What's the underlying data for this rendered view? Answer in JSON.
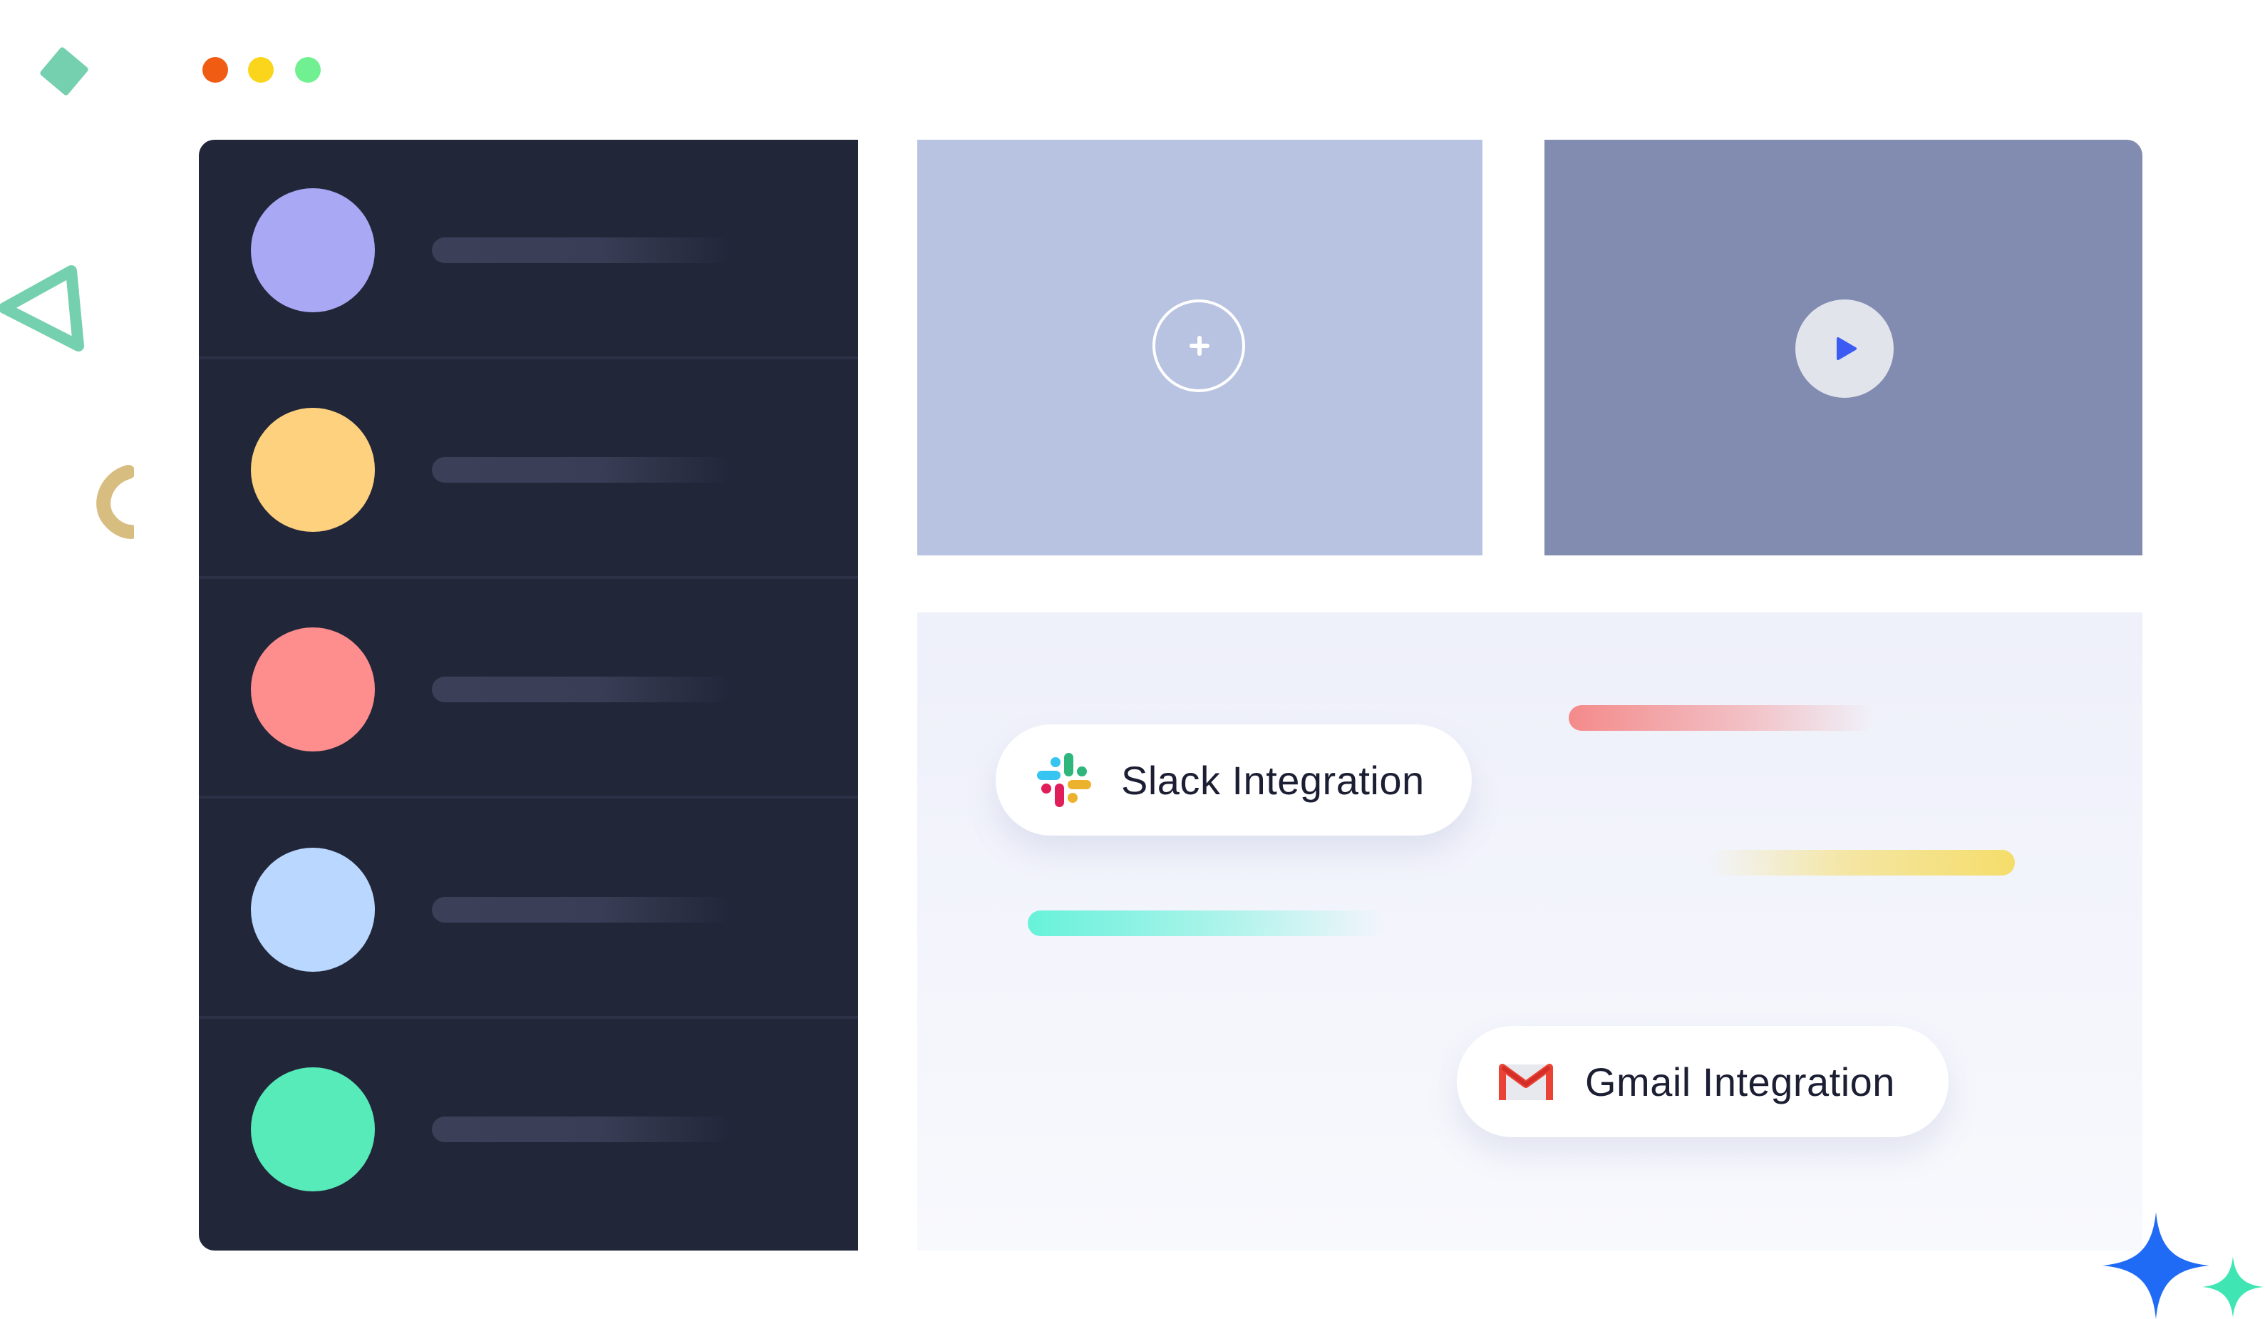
{
  "window": {
    "controls": [
      {
        "name": "close",
        "color": "#ef5c12"
      },
      {
        "name": "minimize",
        "color": "#fad51c"
      },
      {
        "name": "maximize",
        "color": "#70f090"
      }
    ]
  },
  "sidebar": {
    "items": [
      {
        "avatar_color": "#a8a8f5"
      },
      {
        "avatar_color": "#fed17f"
      },
      {
        "avatar_color": "#fe8e8e"
      },
      {
        "avatar_color": "#bad8ff"
      },
      {
        "avatar_color": "#58ebba"
      }
    ]
  },
  "cards": {
    "add": {
      "icon": "plus-icon",
      "color": "#b8c3e2"
    },
    "play": {
      "icon": "play-icon",
      "color": "#818cb0",
      "icon_color": "#3c5bf2"
    }
  },
  "integrations": [
    {
      "label": "Slack Integration",
      "icon": "slack-icon"
    },
    {
      "label": "Gmail Integration",
      "icon": "gmail-icon"
    }
  ],
  "accent_bars": [
    {
      "color": "#f48a8a"
    },
    {
      "color": "#f5dd6a"
    },
    {
      "color": "#67f2da"
    }
  ]
}
